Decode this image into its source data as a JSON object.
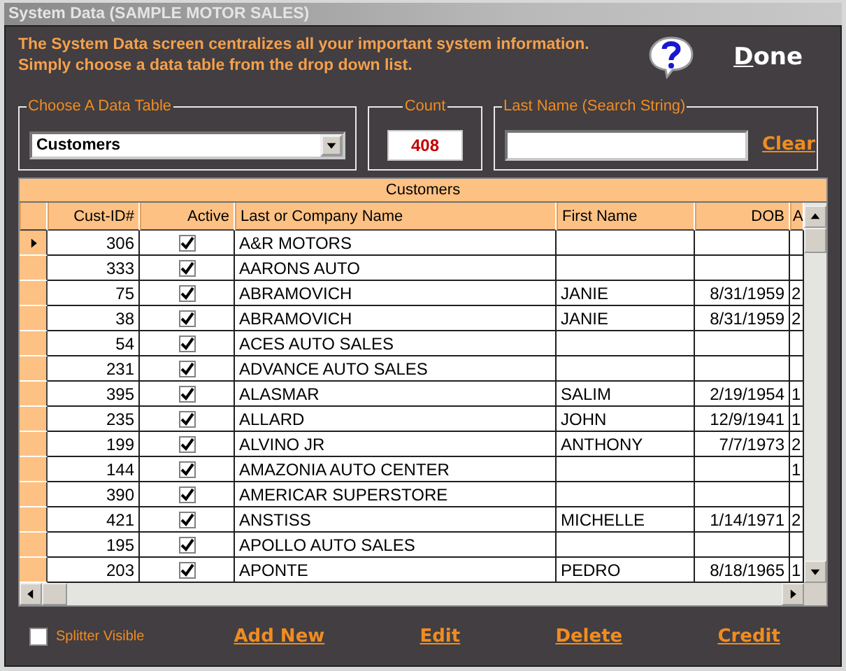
{
  "window": {
    "title": "System Data (SAMPLE MOTOR SALES)"
  },
  "intro": [
    "The System Data screen centralizes all your important system information.",
    "Simply choose a data table from the drop down list."
  ],
  "done_button": "Done",
  "table_picker": {
    "label": "Choose A Data Table",
    "value": "Customers"
  },
  "count": {
    "label": "Count",
    "value": "408"
  },
  "search": {
    "label": "Last Name (Search String)",
    "clear": "Clear"
  },
  "grid": {
    "title": "Customers",
    "columns": [
      "Cust-ID#",
      "Active",
      "Last or Company Name",
      "First Name",
      "DOB",
      "A"
    ],
    "rows": [
      {
        "selected": true,
        "id": "306",
        "active": true,
        "name": "A&R MOTORS",
        "first": "",
        "dob": "",
        "column_6": ""
      },
      {
        "selected": false,
        "id": "333",
        "active": true,
        "name": "AARONS AUTO",
        "first": "",
        "dob": "",
        "column_6": ""
      },
      {
        "selected": false,
        "id": "75",
        "active": true,
        "name": "ABRAMOVICH",
        "first": "JANIE",
        "dob": "8/31/1959",
        "column_6": "2"
      },
      {
        "selected": false,
        "id": "38",
        "active": true,
        "name": "ABRAMOVICH",
        "first": "JANIE",
        "dob": "8/31/1959",
        "column_6": "2"
      },
      {
        "selected": false,
        "id": "54",
        "active": true,
        "name": "ACES AUTO SALES",
        "first": "",
        "dob": "",
        "column_6": ""
      },
      {
        "selected": false,
        "id": "231",
        "active": true,
        "name": "ADVANCE AUTO SALES",
        "first": "",
        "dob": "",
        "column_6": ""
      },
      {
        "selected": false,
        "id": "395",
        "active": true,
        "name": "ALASMAR",
        "first": "SALIM",
        "dob": "2/19/1954",
        "column_6": "1"
      },
      {
        "selected": false,
        "id": "235",
        "active": true,
        "name": "ALLARD",
        "first": "JOHN",
        "dob": "12/9/1941",
        "column_6": "1"
      },
      {
        "selected": false,
        "id": "199",
        "active": true,
        "name": "ALVINO  JR",
        "first": "ANTHONY",
        "dob": "7/7/1973",
        "column_6": "2"
      },
      {
        "selected": false,
        "id": "144",
        "active": true,
        "name": "AMAZONIA AUTO CENTER",
        "first": "",
        "dob": "",
        "column_6": "1"
      },
      {
        "selected": false,
        "id": "390",
        "active": true,
        "name": "AMERICAR SUPERSTORE",
        "first": "",
        "dob": "",
        "column_6": ""
      },
      {
        "selected": false,
        "id": "421",
        "active": true,
        "name": "ANSTISS",
        "first": "MICHELLE",
        "dob": "1/14/1971",
        "column_6": "2"
      },
      {
        "selected": false,
        "id": "195",
        "active": true,
        "name": "APOLLO AUTO SALES",
        "first": "",
        "dob": "",
        "column_6": ""
      },
      {
        "selected": false,
        "id": "203",
        "active": true,
        "name": "APONTE",
        "first": "PEDRO",
        "dob": "8/18/1965",
        "column_6": "1"
      }
    ]
  },
  "splitter": {
    "label": "Splitter Visible",
    "checked": false
  },
  "actions": [
    "Add New",
    "Edit",
    "Delete",
    "Credit"
  ]
}
